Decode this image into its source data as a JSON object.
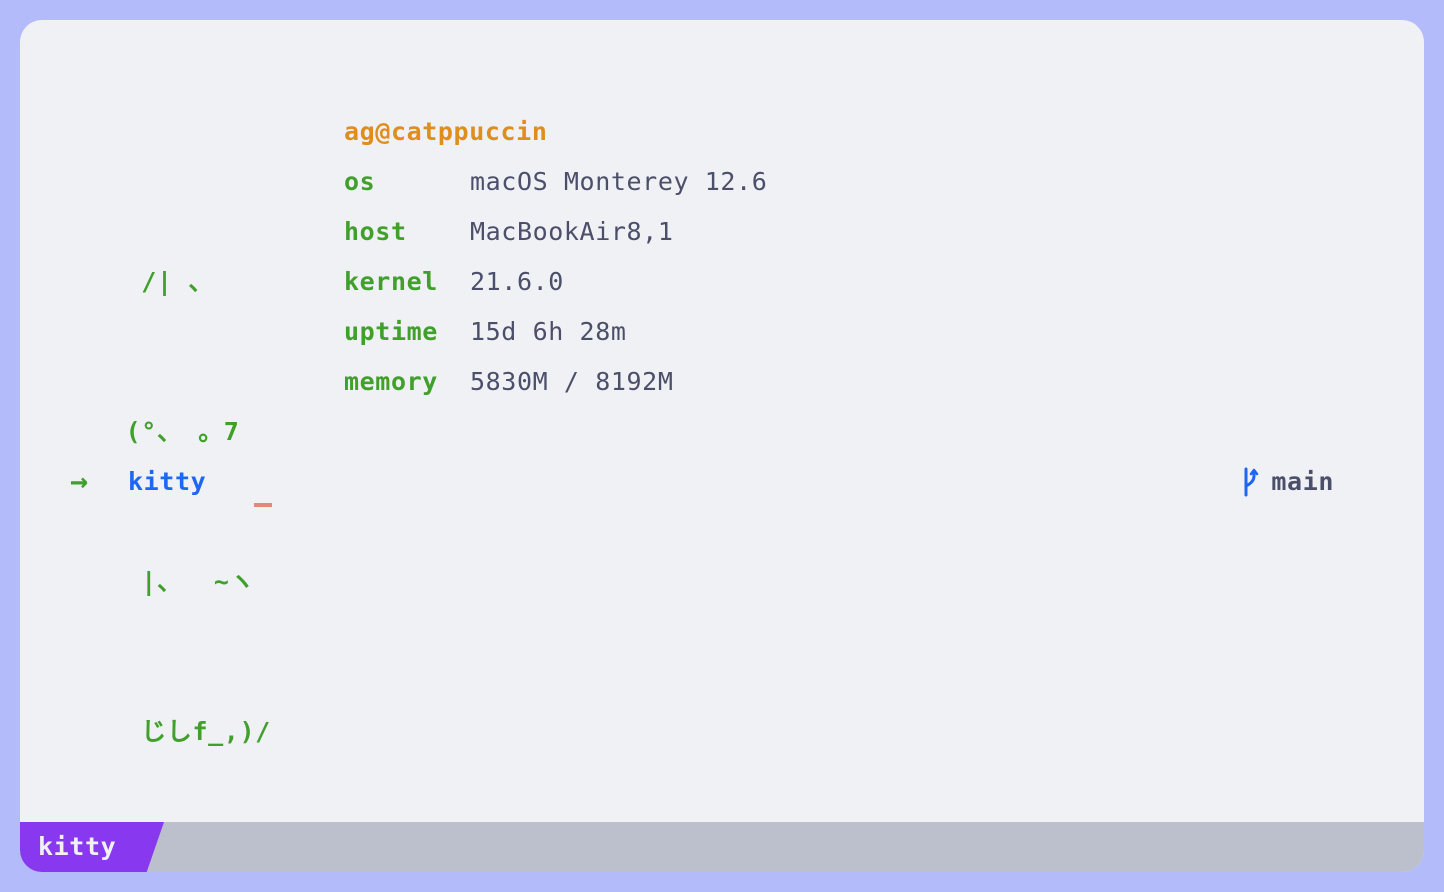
{
  "ascii_art": [
    "  /| 、",
    " (°、 。7",
    "  |、  ~ヽ",
    "  じしf_,)/"
  ],
  "userhost": "ag@catppuccin",
  "info": [
    {
      "key": "os",
      "value": "macOS Monterey 12.6"
    },
    {
      "key": "host",
      "value": "MacBookAir8,1"
    },
    {
      "key": "kernel",
      "value": "21.6.0"
    },
    {
      "key": "uptime",
      "value": "15d 6h 28m"
    },
    {
      "key": "memory",
      "value": "5830M / 8192M"
    }
  ],
  "prompt": {
    "arrow": "→",
    "directory": "kitty",
    "branch_icon": "git-branch-icon",
    "branch": "main"
  },
  "tabbar": {
    "active_tab": "kitty"
  },
  "colors": {
    "background": "#eff1f5",
    "frame": "#b4bbfb",
    "green": "#40a02b",
    "yellow": "#df8e1d",
    "blue": "#1e66f5",
    "text": "#4c4f69",
    "cursor": "#e6867a",
    "tab_active": "#8839ef",
    "tabbar": "#bcc0cc"
  }
}
